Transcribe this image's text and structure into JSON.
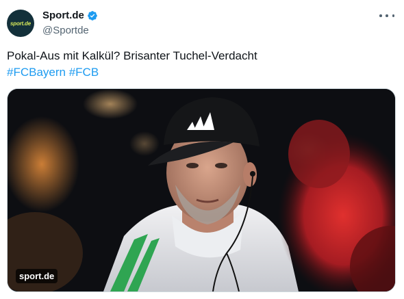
{
  "account": {
    "display_name": "Sport.de",
    "handle": "@Sportde",
    "avatar_text": "sport.de",
    "verified_icon": "verified-badge-icon",
    "verified_color": "#1d9bf0"
  },
  "post": {
    "text": "Pokal-Aus mit Kalkül? Brisanter Tuchel-Verdacht",
    "hashtags": [
      "#FCBayern",
      "#FCB"
    ],
    "link_color": "#1d9bf0"
  },
  "media": {
    "source_label": "sport.de"
  },
  "more_icon": "more-options-icon"
}
